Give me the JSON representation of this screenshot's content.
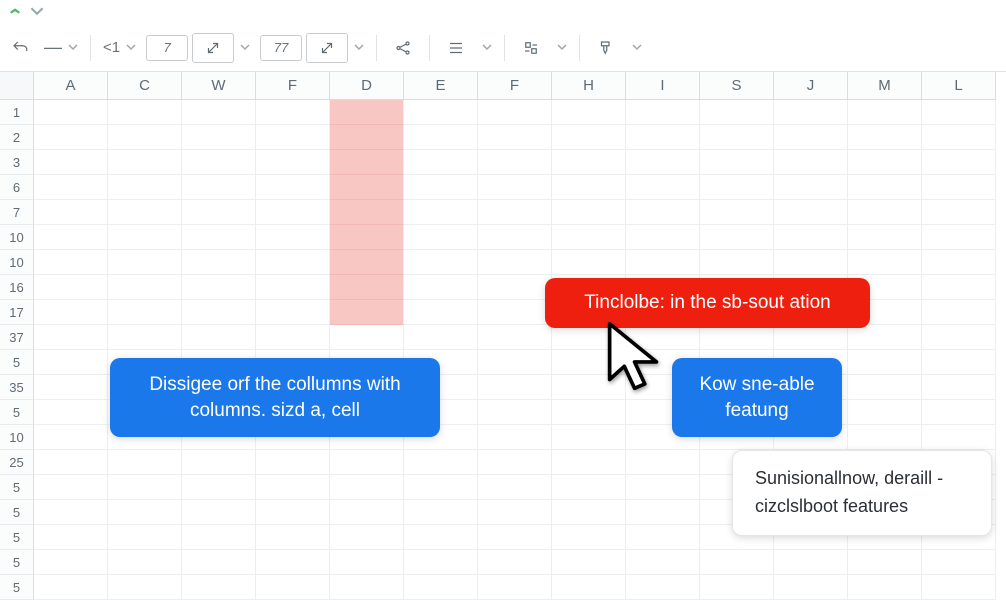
{
  "menu": {
    "dropdown_indicator": "▾"
  },
  "toolbar": {
    "num1": "7",
    "num2": "77"
  },
  "columns": [
    "A",
    "C",
    "W",
    "F",
    "D",
    "E",
    "F",
    "H",
    "I",
    "S",
    "J",
    "M",
    "L"
  ],
  "rows": [
    "1",
    "2",
    "3",
    "6",
    "7",
    "10",
    "10",
    "16",
    "17",
    "37",
    "5",
    "35",
    "5",
    "10",
    "25",
    "5",
    "5",
    "5",
    "5",
    "5"
  ],
  "highlight": {
    "col_index": 4,
    "row_start": 0,
    "row_end": 8
  },
  "callouts": {
    "blue1": "Dissigee orf the collumns with\ncolumns. sizd a, cell",
    "red1": "Tinclolbe: in the sb-sout ation",
    "blue2": "Kow sne-able\nfeatung",
    "white1": "Sunisionallnow, deraill -\ncizclslboot features"
  },
  "icons": {
    "arrow_down": "chevron-down",
    "anchor1": "<1",
    "cursor": "pointer"
  }
}
